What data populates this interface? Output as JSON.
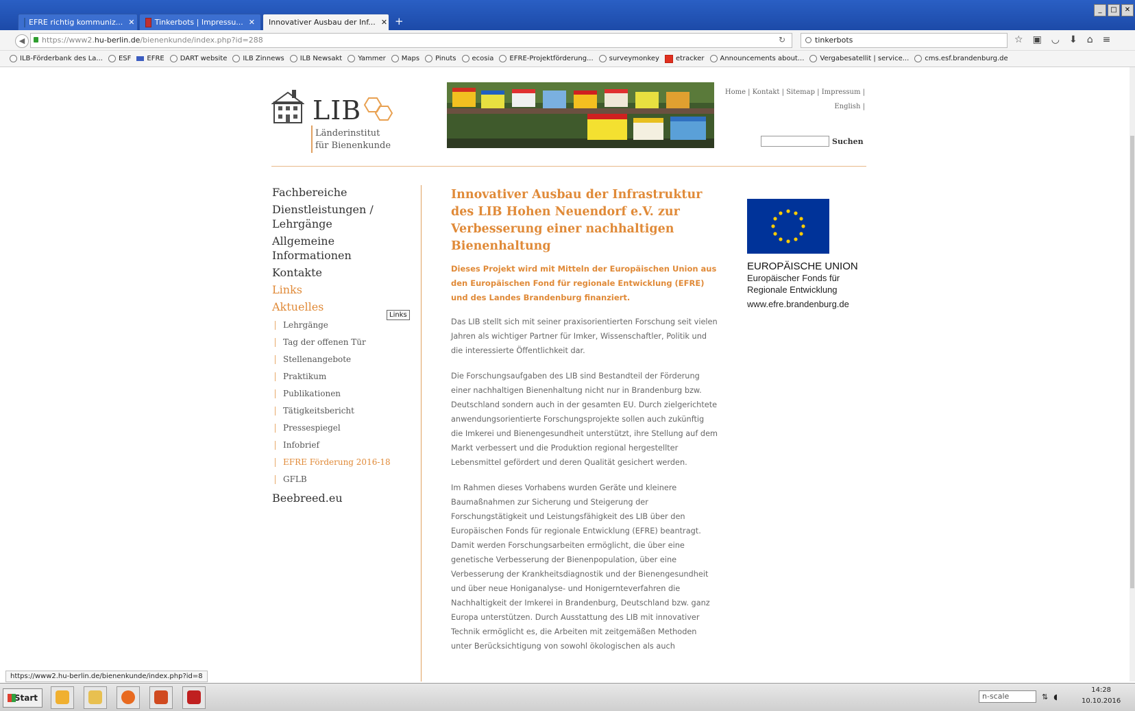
{
  "browser": {
    "tabs": [
      {
        "label": "EFRE richtig kommuniz..."
      },
      {
        "label": "Tinkerbots | Impressu..."
      },
      {
        "label": "Innovativer Ausbau der Inf..."
      }
    ],
    "new_tab_glyph": "+",
    "url_prefix": "https://www2.",
    "url_domain": "hu-berlin.de",
    "url_path": "/bienenkunde/index.php?id=288",
    "search_value": "tinkerbots",
    "bookmarks": [
      "ILB-Förderbank des La...",
      "ESF",
      "EFRE",
      "DART website",
      "ILB Zinnews",
      "ILB Newsakt",
      "Yammer",
      "Maps",
      "Pinuts",
      "ecosia",
      "EFRE-Projektförderung...",
      "surveymonkey",
      "etracker",
      "Announcements about...",
      "Vergabesatellit | service...",
      "cms.esf.brandenburg.de"
    ],
    "status_url": "https://www2.hu-berlin.de/bienenkunde/index.php?id=8"
  },
  "site": {
    "logo_text": "LIB",
    "logo_sub1": "Länderinstitut",
    "logo_sub2": "für Bienenkunde",
    "toplinks_line1": "Home | Kontakt | Sitemap | Impressum |",
    "toplinks_line2": "English |",
    "search_button": "Suchen",
    "nav": [
      {
        "label": "Fachbereiche"
      },
      {
        "label": "Dienstleistungen / Lehrgänge"
      },
      {
        "label": "Allgemeine Informationen"
      },
      {
        "label": "Kontakte"
      },
      {
        "label": "Links"
      },
      {
        "label": "Aktuelles"
      }
    ],
    "subnav": [
      {
        "label": "Lehrgänge"
      },
      {
        "label": "Tag der offenen Tür"
      },
      {
        "label": "Stellenangebote"
      },
      {
        "label": "Praktikum"
      },
      {
        "label": "Publikationen"
      },
      {
        "label": "Tätigkeitsbericht"
      },
      {
        "label": "Pressespiegel"
      },
      {
        "label": "Infobrief"
      },
      {
        "label": "EFRE Förderung 2016-18"
      },
      {
        "label": "GFLB"
      }
    ],
    "nav_last": "Beebreed.eu",
    "tooltip": "Links",
    "title": "Innovativer Ausbau der Infrastruktur des LIB Hohen Neuendorf e.V. zur Verbesserung einer nachhaltigen Bienenhaltung",
    "intro": "Dieses Projekt wird mit Mitteln der Europäischen Union aus den Europäischen Fond für regionale Entwicklung (EFRE) und des Landes Brandenburg finanziert.",
    "paragraphs": [
      "Das LIB stellt sich mit seiner praxisorientierten Forschung seit vielen Jahren als wichtiger Partner für Imker, Wissenschaftler, Politik und die interessierte Öffentlichkeit dar.",
      "Die Forschungsaufgaben des LIB sind Bestandteil der Förderung einer nachhaltigen Bienenhaltung nicht nur in Brandenburg bzw. Deutschland sondern auch in der gesamten EU. Durch zielgerichtete anwendungsorientierte Forschungsprojekte sollen auch zukünftig die Imkerei und Bienengesundheit unterstützt, ihre Stellung auf dem Markt verbessert und die Produktion regional hergestellter Lebensmittel gefördert und deren Qualität gesichert werden.",
      "Im Rahmen dieses Vorhabens wurden Geräte und kleinere Baumaßnahmen zur Sicherung und Steigerung der Forschungstätigkeit und Leistungsfähigkeit des LIB über den Europäischen Fonds für regionale Entwicklung (EFRE) beantragt. Damit werden Forschungsarbeiten ermöglicht, die über eine genetische Verbesserung der Bienenpopulation, über eine Verbesserung der Krankheitsdiagnostik und der Bienengesundheit und über neue Honiganalyse- und Honigernteverfahren die Nachhaltigkeit der Imkerei in Brandenburg, Deutschland bzw. ganz Europa unterstützen. Durch Ausstattung des LIB mit innovativer Technik ermöglicht es, die Arbeiten mit zeitgemäßen Methoden unter Berücksichtigung von sowohl ökologischen als auch"
    ],
    "eu_title": "EUROPÄISCHE UNION",
    "eu_sub1": "Europäischer Fonds für",
    "eu_sub2": "Regionale Entwicklung",
    "eu_url": "www.efre.brandenburg.de"
  },
  "taskbar": {
    "start_label": "Start",
    "tray_input": "n-scale",
    "clock_time": "14:28",
    "clock_date": "10.10.2016"
  },
  "colors": {
    "accent": "#e08a38",
    "eu_blue": "#003399",
    "eu_star": "#ffcc00",
    "titlebar": "#2a5fc4"
  }
}
